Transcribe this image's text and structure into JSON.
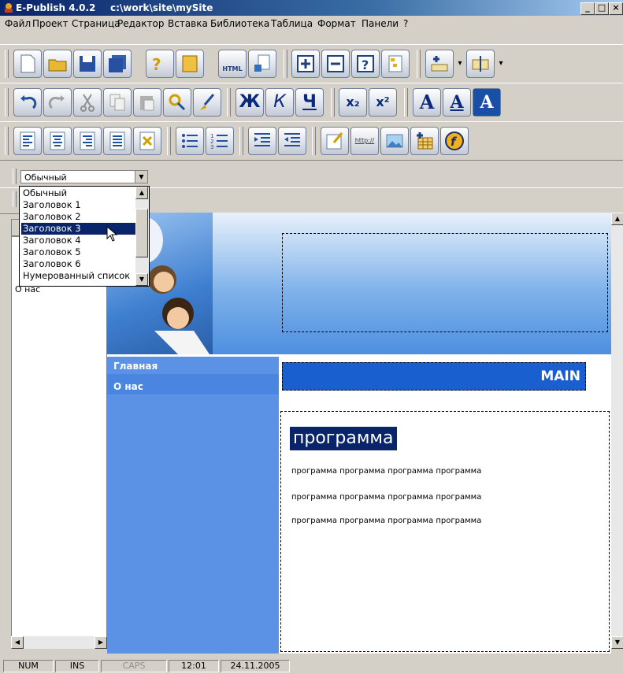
{
  "window": {
    "app_name": "E-Publish 4.0.2",
    "path": "c:\\work\\site\\mySite",
    "minimize": "_",
    "maximize": "□",
    "close": "×"
  },
  "menu": [
    "Файл",
    "Проект",
    "Страница",
    "Редактор",
    "Вставка",
    "Библиотека",
    "Таблица",
    "Формат",
    "Панели",
    "?"
  ],
  "toolbar2_letters": {
    "bold": "Ж",
    "italic": "К",
    "underline": "Ч",
    "sub": "x₂",
    "sup": "x²",
    "font1": "A",
    "font2": "A",
    "font3": "A"
  },
  "toolbar1_labels": {
    "html": "HTML"
  },
  "toolbar3_labels": {
    "link": "http://"
  },
  "style_combo": {
    "value": "Обычный"
  },
  "style_options": [
    "Обычный",
    "Заголовок 1",
    "Заголовок 2",
    "Заголовок 3",
    "Заголовок 4",
    "Заголовок 5",
    "Заголовок 6",
    "Нумерованный список"
  ],
  "selected_option": "Заголовок 3",
  "left_panel": {
    "tree_item": "О нас"
  },
  "page": {
    "nav": [
      "Главная",
      "О нас"
    ],
    "main_title": "MAIN",
    "heading": "программа",
    "paragraphs": [
      "программа программа программа программа",
      "программа программа программа программа",
      "программа программа программа программа"
    ]
  },
  "status": {
    "num": "NUM",
    "ins": "INS",
    "caps": "CAPS",
    "time": "12:01",
    "date": "24.11.2005"
  },
  "colors": {
    "nav_bg": "#5b92e5",
    "main_bar": "#1a5fd0",
    "selection": "#0a246a"
  }
}
